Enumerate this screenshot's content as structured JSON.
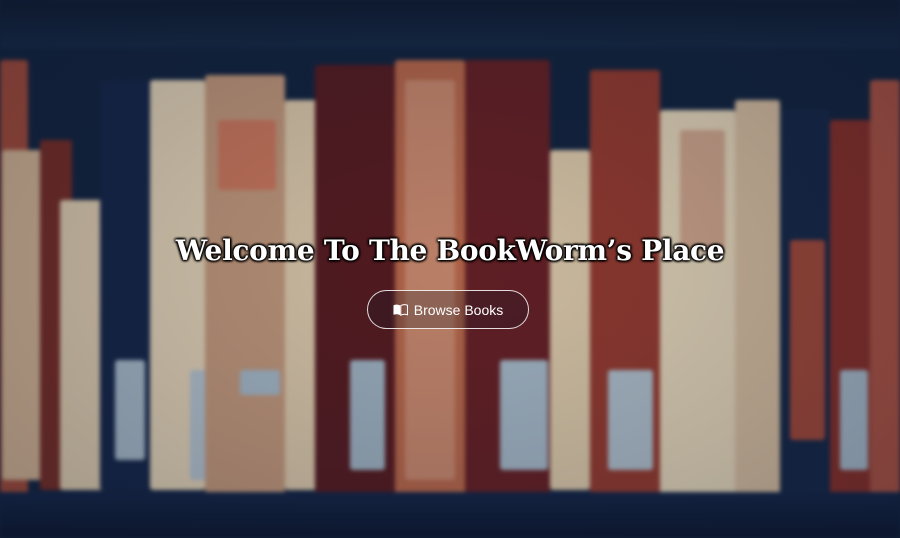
{
  "hero": {
    "title": "Welcome To The BookWorm’s Place",
    "browse_button_label": "Browse Books",
    "browse_button_icon": "open-book-icon"
  },
  "colors": {
    "navy": "#13233e",
    "cream": "#e8d4b2",
    "rust": "#a8402c",
    "maroon": "#5e1a1e",
    "pale_blue": "#9fb5c8",
    "text": "#ffffff"
  }
}
